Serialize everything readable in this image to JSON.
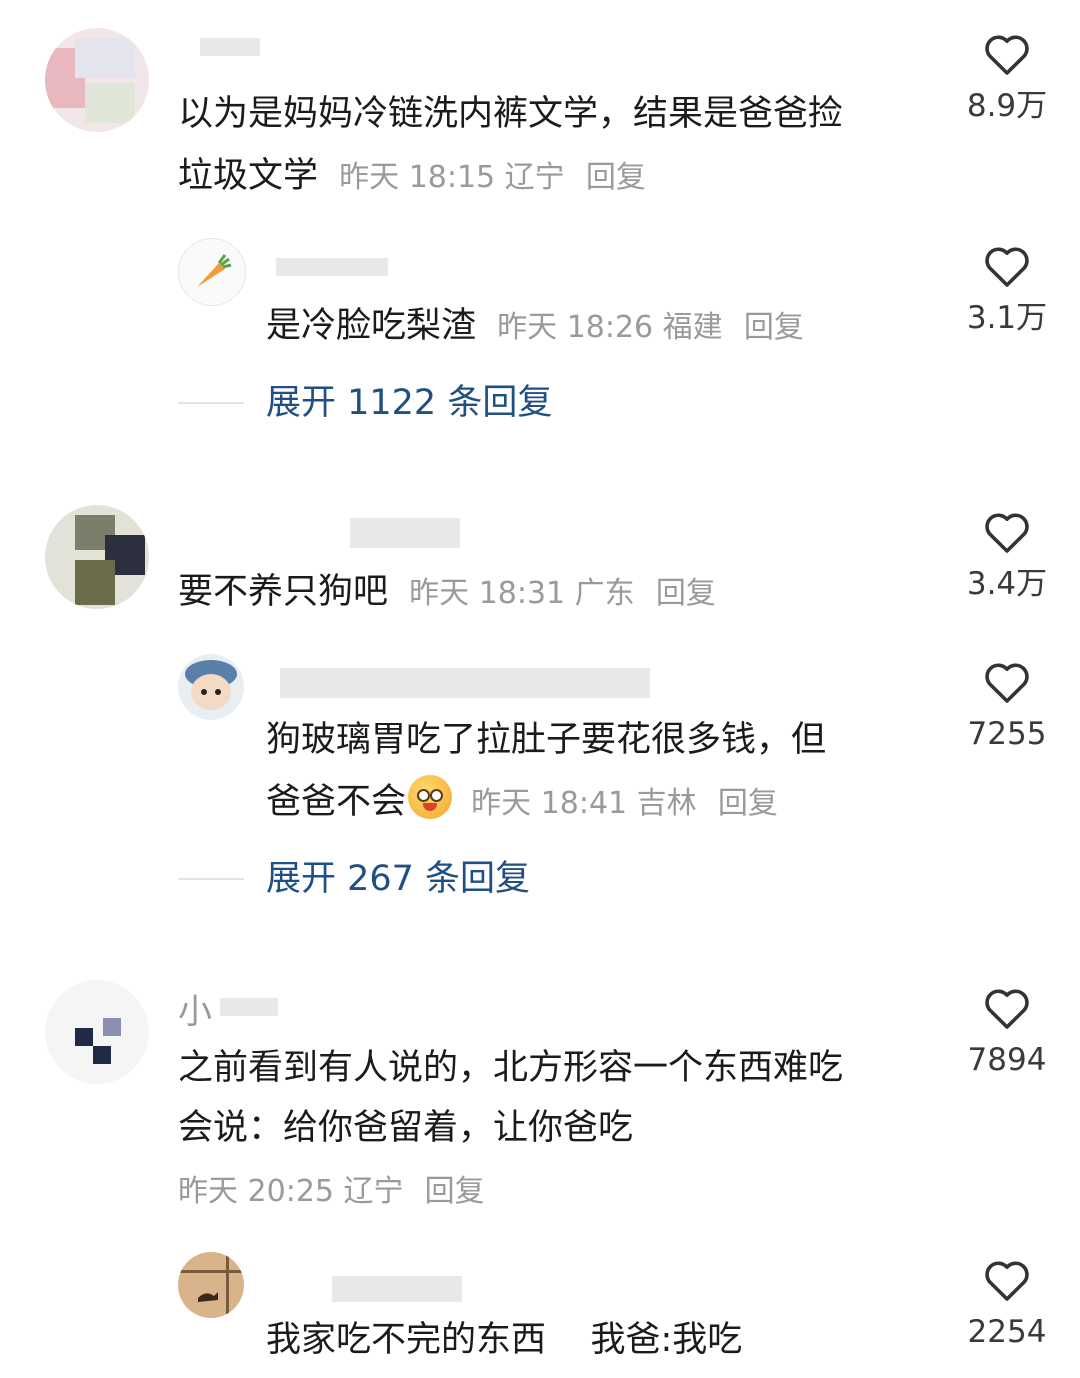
{
  "comments": [
    {
      "text_line1": "以为是妈妈冷链洗内裤文学，结果是爸爸捡",
      "text_line2": "垃圾文学",
      "meta": "昨天 18:15 辽宁",
      "reply_label": "回复",
      "likes": "8.9万",
      "replies": [
        {
          "text": "是冷脸吃梨渣",
          "meta": "昨天 18:26 福建",
          "reply_label": "回复",
          "likes": "3.1万"
        }
      ],
      "expand_label": "展开 1122 条回复"
    },
    {
      "text_line1": "要不养只狗吧",
      "meta": "昨天 18:31 广东",
      "reply_label": "回复",
      "likes": "3.4万",
      "replies": [
        {
          "text_line1": "狗玻璃胃吃了拉肚子要花很多钱，但",
          "text_line2": "爸爸不会",
          "meta": "昨天 18:41 吉林",
          "reply_label": "回复",
          "likes": "7255"
        }
      ],
      "expand_label": "展开 267 条回复"
    },
    {
      "name_visible": "小",
      "text_line1": "之前看到有人说的，北方形容一个东西难吃",
      "text_line2": "会说：给你爸留着，让你爸吃",
      "meta": "昨天 20:25 辽宁",
      "reply_label": "回复",
      "likes": "7894",
      "replies": [
        {
          "text": "我家吃不完的东西    我爸:我吃",
          "likes": "2254"
        }
      ]
    }
  ],
  "icons": {
    "like": "heart-outline-icon",
    "emoji": "grinning-face-emoji"
  }
}
